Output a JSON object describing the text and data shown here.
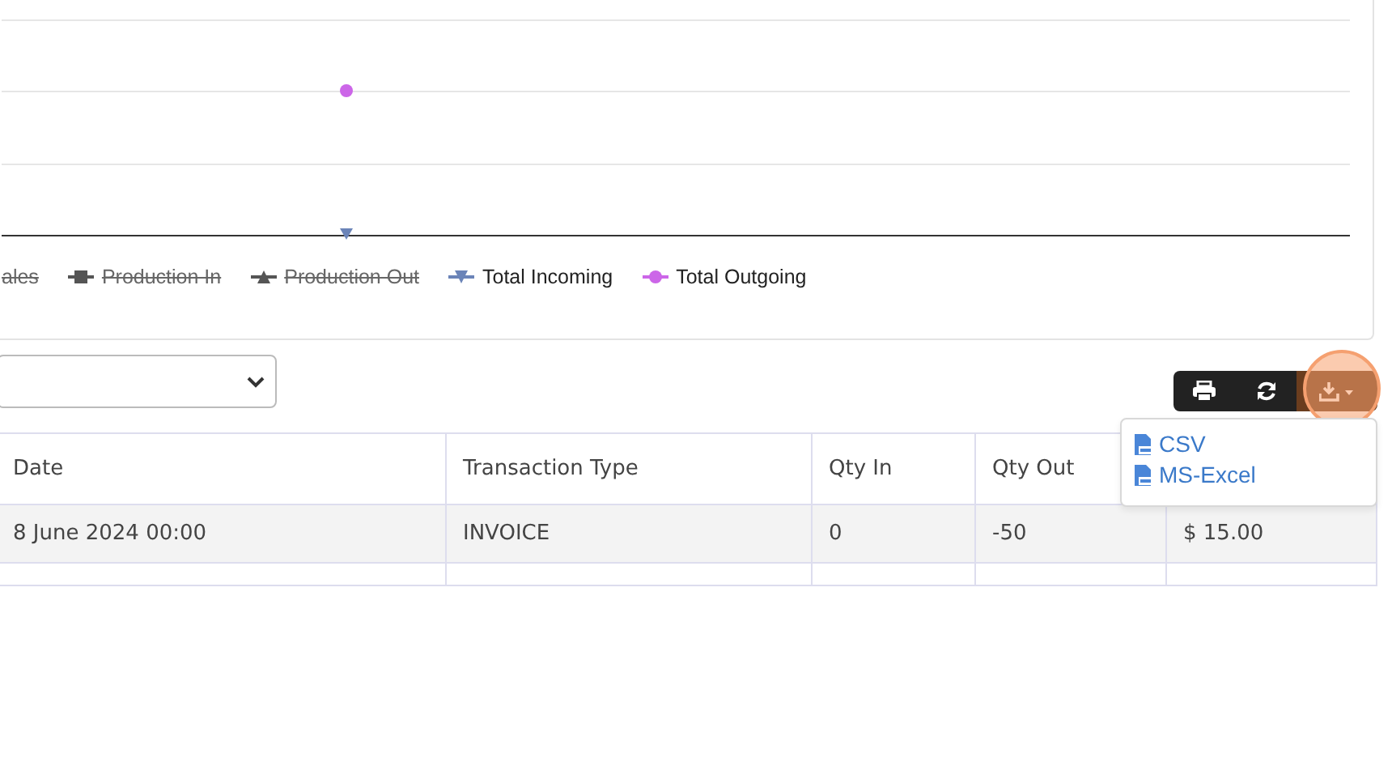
{
  "chart": {
    "legend": [
      {
        "label": "ales",
        "kind": "cut",
        "hidden": true
      },
      {
        "label": "Production In",
        "kind": "square",
        "color": "#555555",
        "hidden": true
      },
      {
        "label": "Production Out",
        "kind": "triangle",
        "color": "#555555",
        "hidden": true
      },
      {
        "label": "Total Incoming",
        "kind": "triangle-down",
        "color": "#6b84b8",
        "hidden": false
      },
      {
        "label": "Total Outgoing",
        "kind": "circle",
        "color": "#cc66e8",
        "hidden": false
      }
    ]
  },
  "toolbar": {
    "buttons": [
      {
        "kind": "print"
      },
      {
        "kind": "refresh"
      },
      {
        "kind": "download",
        "highlighted": true
      }
    ],
    "export_menu": [
      {
        "label": "CSV"
      },
      {
        "label": "MS-Excel"
      }
    ]
  },
  "table": {
    "columns": [
      "Date",
      "Transaction Type",
      "Qty In",
      "Qty Out"
    ],
    "rows": [
      [
        "8 June 2024 00:00",
        "INVOICE",
        "0",
        "-50",
        "$ 15.00"
      ]
    ]
  }
}
